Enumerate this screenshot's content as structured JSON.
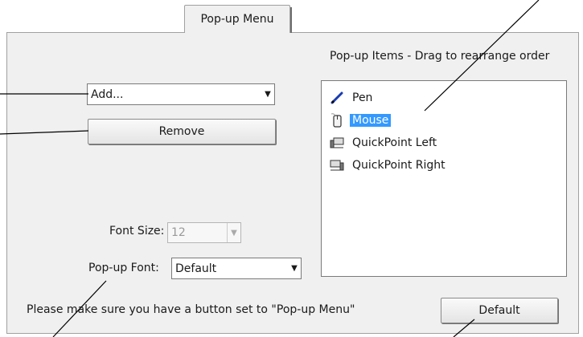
{
  "tab": {
    "label": "Pop-up Menu"
  },
  "list_header": "Pop-up Items - Drag to rearrange order",
  "add_combo": {
    "value": "Add...",
    "arrow": "▼"
  },
  "remove_button": "Remove",
  "list_items": [
    {
      "label": "Pen",
      "icon": "pen-icon",
      "selected": false
    },
    {
      "label": "Mouse",
      "icon": "mouse-icon",
      "selected": true
    },
    {
      "label": "QuickPoint Left",
      "icon": "quickpoint-left-icon",
      "selected": false
    },
    {
      "label": "QuickPoint Right",
      "icon": "quickpoint-right-icon",
      "selected": false
    }
  ],
  "font_size": {
    "label": "Font Size:",
    "value": "12",
    "disabled": true
  },
  "popup_font": {
    "label": "Pop-up Font:",
    "value": "Default"
  },
  "note": "Please make sure you have a button set to \"Pop-up Menu\"",
  "default_button": "Default",
  "colors": {
    "selection": "#3399ff",
    "panel": "#f0f0f0",
    "pen_icon": "#1a3cb0"
  }
}
